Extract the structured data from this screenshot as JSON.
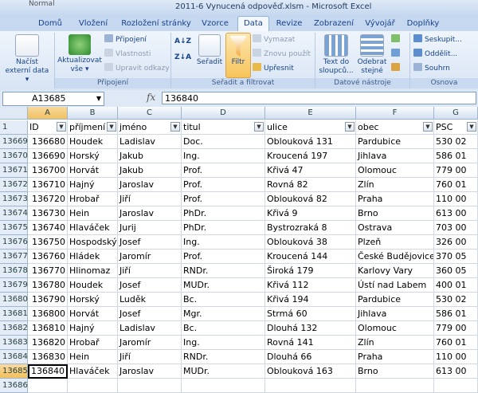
{
  "app": {
    "window_title": "2011-6 Vynucená odpověď.xlsm - Microsoft Excel",
    "style_hint": "Normal"
  },
  "ribbon_tabs": [
    {
      "label": "Domů",
      "active": false
    },
    {
      "label": "Vložení",
      "active": false
    },
    {
      "label": "Rozložení stránky",
      "active": false
    },
    {
      "label": "Vzorce",
      "active": false
    },
    {
      "label": "Data",
      "active": true
    },
    {
      "label": "Revize",
      "active": false
    },
    {
      "label": "Zobrazení",
      "active": false
    },
    {
      "label": "Vývojář",
      "active": false
    },
    {
      "label": "Doplňky",
      "active": false
    }
  ],
  "ribbon": {
    "groups": {
      "connections": "Připojení",
      "sort_filter": "Seřadit a filtrovat",
      "data_tools": "Datové nástroje",
      "outline": "Osnova"
    },
    "external_data": {
      "line1": "Načíst",
      "line2": "externí data ▾"
    },
    "refresh_all": {
      "line1": "Aktualizovat",
      "line2": "vše ▾"
    },
    "connections_btn": "Připojení",
    "properties_btn": "Vlastnosti",
    "edit_links_btn": "Upravit odkazy",
    "sort_btn": "Seřadit",
    "filter_btn": "Filtr",
    "clear_btn": "Vymazat",
    "reapply_btn": "Znovu použít",
    "advanced_btn": "Upřesnit",
    "text_to_columns": {
      "line1": "Text do",
      "line2": "sloupců..."
    },
    "remove_duplicates": {
      "line1": "Odebrat",
      "line2": "stejné"
    },
    "group_btn": "Seskupit...",
    "ungroup_btn": "Oddělit...",
    "subtotal_btn": "Souhrn"
  },
  "formula_bar": {
    "name_box": "A13685",
    "fx": "fx",
    "value": "136840"
  },
  "columns": [
    "A",
    "B",
    "C",
    "D",
    "E",
    "F",
    "G"
  ],
  "header_row": {
    "row_num": "1",
    "cells": [
      "ID",
      "příjmení",
      "jméno",
      "titul",
      "ulice",
      "obec",
      "PSC"
    ]
  },
  "rows": [
    {
      "n": "13669",
      "c": [
        "136680",
        "Houdek",
        "Ladislav",
        "Doc.",
        "Oblouková 131",
        "Pardubice",
        "530 02"
      ]
    },
    {
      "n": "13670",
      "c": [
        "136690",
        "Horský",
        "Jakub",
        "Ing.",
        "Kroucená 197",
        "Jihlava",
        "586 01"
      ]
    },
    {
      "n": "13671",
      "c": [
        "136700",
        "Horvát",
        "Jakub",
        "Prof.",
        "Křivá 47",
        "Olomouc",
        "779 00"
      ]
    },
    {
      "n": "13672",
      "c": [
        "136710",
        "Hajný",
        "Jaroslav",
        "Prof.",
        "Rovná 82",
        "Zlín",
        "760 01"
      ]
    },
    {
      "n": "13673",
      "c": [
        "136720",
        "Hrobař",
        "Jiří",
        "Prof.",
        "Oblouková 82",
        "Praha",
        "110 00"
      ]
    },
    {
      "n": "13674",
      "c": [
        "136730",
        "Hein",
        "Jaroslav",
        "PhDr.",
        "Křivá 9",
        "Brno",
        "613 00"
      ]
    },
    {
      "n": "13675",
      "c": [
        "136740",
        "Hlaváček",
        "Jurij",
        "PhDr.",
        "Bystrozraká 8",
        "Ostrava",
        "703 00"
      ]
    },
    {
      "n": "13676",
      "c": [
        "136750",
        "Hospodský",
        "Josef",
        "Ing.",
        "Oblouková 38",
        "Plzeň",
        "326 00"
      ]
    },
    {
      "n": "13677",
      "c": [
        "136760",
        "Hládek",
        "Jaromír",
        "Prof.",
        "Kroucená 144",
        "České Budějovice",
        "370 05"
      ]
    },
    {
      "n": "13678",
      "c": [
        "136770",
        "Hlinomaz",
        "Jiří",
        "RNDr.",
        "Široká 179",
        "Karlovy Vary",
        "360 05"
      ]
    },
    {
      "n": "13679",
      "c": [
        "136780",
        "Houdek",
        "Josef",
        "MUDr.",
        "Křivá 112",
        "Ústí nad Labem",
        "400 01"
      ]
    },
    {
      "n": "13680",
      "c": [
        "136790",
        "Horský",
        "Luděk",
        "Bc.",
        "Křivá 194",
        "Pardubice",
        "530 02"
      ]
    },
    {
      "n": "13681",
      "c": [
        "136800",
        "Horvát",
        "Josef",
        "Mgr.",
        "Strmá 60",
        "Jihlava",
        "586 01"
      ]
    },
    {
      "n": "13682",
      "c": [
        "136810",
        "Hajný",
        "Ladislav",
        "Bc.",
        "Dlouhá 132",
        "Olomouc",
        "779 00"
      ]
    },
    {
      "n": "13683",
      "c": [
        "136820",
        "Hrobař",
        "Jaromír",
        "Ing.",
        "Rovná 141",
        "Zlín",
        "760 01"
      ]
    },
    {
      "n": "13684",
      "c": [
        "136830",
        "Hein",
        "Jiří",
        "RNDr.",
        "Dlouhá 66",
        "Praha",
        "110 00"
      ]
    },
    {
      "n": "13685",
      "c": [
        "136840",
        "Hlaváček",
        "Jaroslav",
        "MUDr.",
        "Oblouková 163",
        "Brno",
        "613 00"
      ],
      "selected": true
    },
    {
      "n": "13686",
      "c": [
        "",
        "",
        "",
        "",
        "",
        "",
        ""
      ]
    }
  ]
}
